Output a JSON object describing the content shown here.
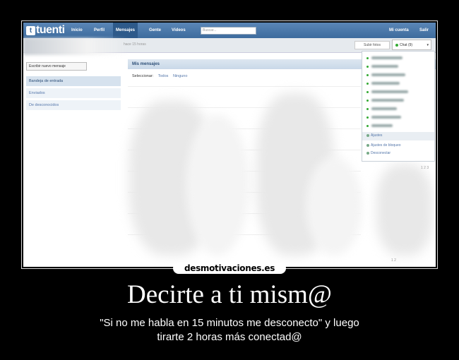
{
  "app": {
    "logo_letter": "t",
    "logo_text": "tuenti"
  },
  "nav": {
    "items": [
      "Inicio",
      "Perfil",
      "Mensajes",
      "Gente",
      "Vídeos"
    ],
    "search_placeholder": "Buscar...",
    "account": "Mi cuenta",
    "logout": "Salir"
  },
  "subbar": {
    "status": "hace 15 horas",
    "upload_label": "Subir fotos",
    "chat_label": "Chat (9)"
  },
  "sidebar": {
    "write_label": "Escribir nuevo mensaje",
    "items": [
      "Bandeja de entrada",
      "Enviados",
      "De desconocidos"
    ]
  },
  "main": {
    "header": "Mis mensajes",
    "select_label": "Seleccionar:",
    "select_all": "Todos",
    "select_none": "Ninguno",
    "page_a": "1 2 3",
    "page_b": "1 2"
  },
  "chat_panel": {
    "settings": "Ajustes",
    "block_settings": "Ajustes de bloqueo",
    "disconnect": "Desconectar"
  },
  "poster": {
    "site": "desmotivaciones.es",
    "title": "Decirte a ti mism@",
    "caption_line1": "\"Si no me habla en 15 minutos me desconecto\" y luego",
    "caption_line2": "tirarte 2 horas más conectad@"
  },
  "colors": {
    "accent": "#3d6b9d",
    "background": "#000000",
    "online": "#33aa33"
  }
}
